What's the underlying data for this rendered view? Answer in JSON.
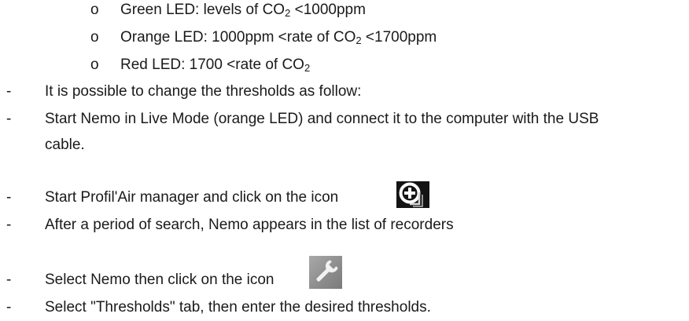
{
  "levels": [
    {
      "bullet": "o",
      "prefix": "Green LED: levels of CO",
      "sub": "2",
      "suffix": " <1000ppm"
    },
    {
      "bullet": "o",
      "prefix": "Orange LED: 1000ppm <rate of CO",
      "sub": "2",
      "suffix": " <1700ppm"
    },
    {
      "bullet": "o",
      "prefix": "Red LED: 1700 <rate of CO",
      "sub": "2",
      "suffix": ""
    }
  ],
  "dash": "-",
  "steps": {
    "change_thresholds": "It is possible to change the thresholds as follow:",
    "start_live_line1": "Start Nemo in Live Mode (orange LED) and connect it to the computer with the USB",
    "start_live_line2": "cable.",
    "start_manager": "Start Profil'Air manager and click on the icon",
    "after_search": "After a period of search, Nemo appears in the list of recorders",
    "select_nemo": "Select Nemo then click on the icon",
    "select_tab": "Select \"Thresholds\" tab, then enter the desired thresholds."
  },
  "icons": {
    "add_recorder": "add-recorder-icon",
    "settings": "wrench-settings-icon"
  }
}
